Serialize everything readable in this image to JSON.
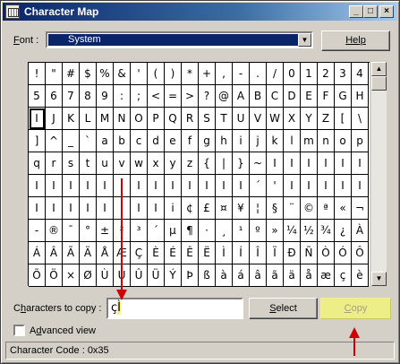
{
  "window": {
    "title": "Character Map"
  },
  "titlebar_buttons": {
    "minimize": "_",
    "maximize": "□",
    "close": "×"
  },
  "font": {
    "label_prefix": "",
    "label_hotkey": "F",
    "label_rest": "ont :",
    "selected": "System"
  },
  "help_button": "Help",
  "grid": {
    "rows": [
      [
        "!",
        "\"",
        "#",
        "$",
        "%",
        "&",
        "'",
        "(",
        ")",
        "*",
        "+",
        ",",
        "-",
        ".",
        "/",
        "0",
        "1",
        "2",
        "3",
        "4"
      ],
      [
        "5",
        "6",
        "7",
        "8",
        "9",
        ":",
        ";",
        "<",
        "=",
        ">",
        "?",
        "@",
        "A",
        "B",
        "C",
        "D",
        "E",
        "F",
        "G",
        "H"
      ],
      [
        "I",
        "J",
        "K",
        "L",
        "M",
        "N",
        "O",
        "P",
        "Q",
        "R",
        "S",
        "T",
        "U",
        "V",
        "W",
        "X",
        "Y",
        "Z",
        "[",
        "\\"
      ],
      [
        "]",
        "^",
        "_",
        "`",
        "a",
        "b",
        "c",
        "d",
        "e",
        "f",
        "g",
        "h",
        "i",
        "j",
        "k",
        "l",
        "m",
        "n",
        "o",
        "p"
      ],
      [
        "q",
        "r",
        "s",
        "t",
        "u",
        "v",
        "w",
        "x",
        "y",
        "z",
        "{",
        "|",
        "}",
        "~",
        "I",
        "I",
        "I",
        "I",
        "I",
        "I"
      ],
      [
        "I",
        "I",
        "I",
        "I",
        "I",
        "I",
        "I",
        "I",
        "I",
        "I",
        "I",
        "I",
        "I",
        "´",
        "'",
        "I",
        "I",
        "I",
        "I",
        "I"
      ],
      [
        "I",
        "I",
        "I",
        "I",
        "I",
        "I",
        "I",
        "I",
        "i",
        "¢",
        "£",
        "¤",
        "¥",
        "¦",
        "§",
        "¨",
        "©",
        "ª",
        "«",
        "¬"
      ],
      [
        "-",
        "®",
        "¯",
        "°",
        "±",
        "²",
        "³",
        "´",
        "µ",
        "¶",
        "·",
        "¸",
        "¹",
        "º",
        "»",
        "¼",
        "½",
        "¾",
        "¿",
        "À"
      ],
      [
        "Á",
        "Â",
        "Ã",
        "Ä",
        "Å",
        "Æ",
        "Ç",
        "È",
        "É",
        "Ê",
        "Ë",
        "Ì",
        "Í",
        "Î",
        "Ï",
        "Ð",
        "Ñ",
        "Ò",
        "Ó",
        "Ô"
      ],
      [
        "Õ",
        "Ö",
        "×",
        "Ø",
        "Ù",
        "Ú",
        "Û",
        "Ü",
        "Ý",
        "Þ",
        "ß",
        "à",
        "á",
        "â",
        "ã",
        "ä",
        "å",
        "æ",
        "ç",
        "è"
      ]
    ],
    "selected_char": "I"
  },
  "copy": {
    "label_prefix": "C",
    "label_hotkey": "h",
    "label_rest": "aracters to copy :",
    "value_plain": "ç",
    "value_highlight": "Ì"
  },
  "select_button": {
    "hotkey": "S",
    "rest": "elect"
  },
  "copy_button": {
    "hotkey": "C",
    "rest": "opy"
  },
  "advanced": {
    "prefix": "A",
    "hotkey": "d",
    "rest": "vanced view",
    "checked": false
  },
  "status": "Character Code : 0x35",
  "colors": {
    "title_start": "#0a246a",
    "highlight": "#eeee88",
    "annotation_arrow": "#cc0000"
  }
}
